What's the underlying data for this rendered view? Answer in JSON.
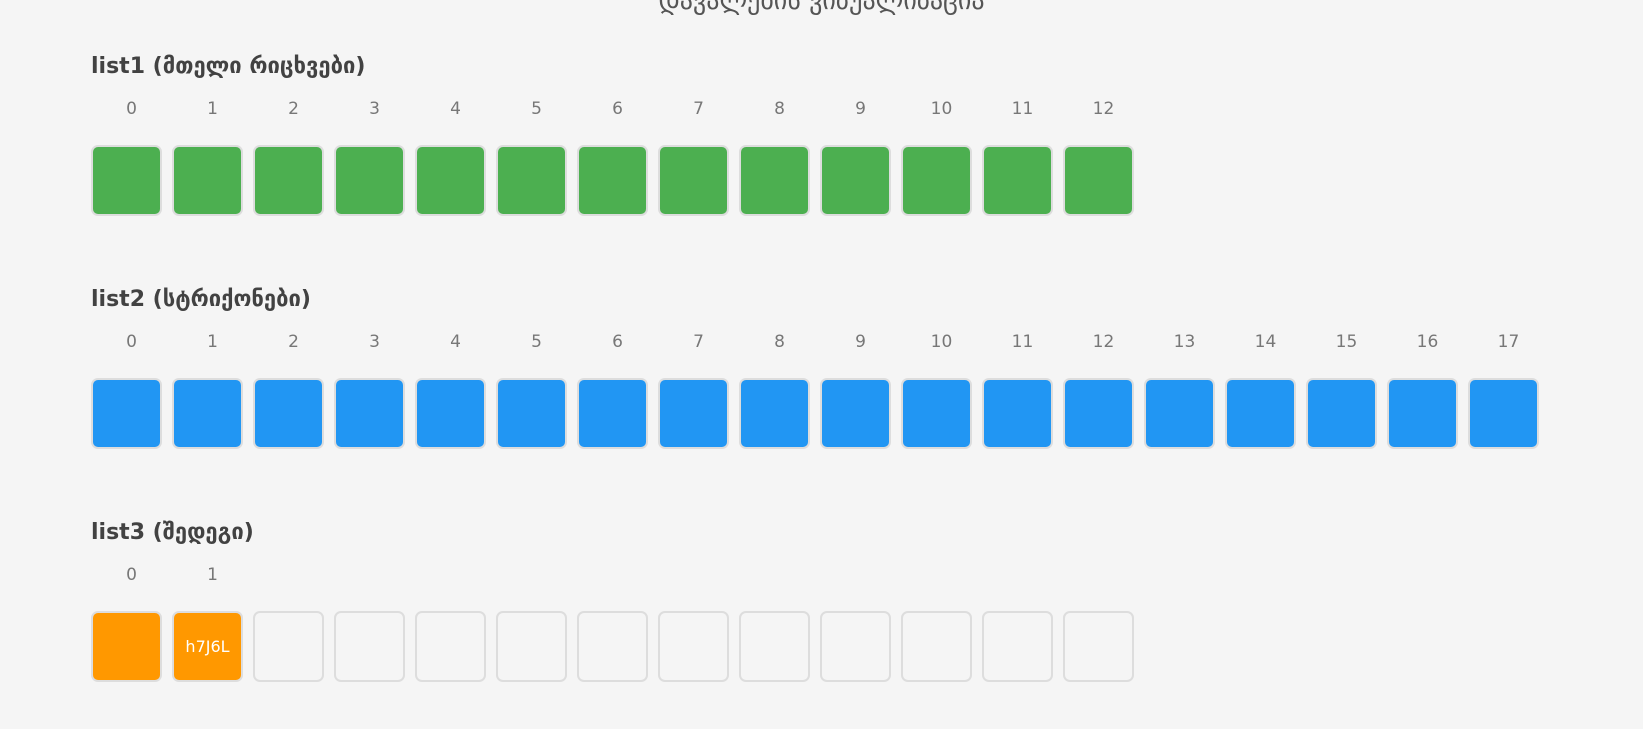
{
  "page": {
    "title": "დავალების ვიზუალიზაცია"
  },
  "colors": {
    "int": "#4caf50",
    "str": "#2196f3",
    "result": "#ff9800",
    "empty_border": "#dddddd"
  },
  "list1": {
    "title": "list1 (მთელი რიცხვები)",
    "indices": [
      "0",
      "1",
      "2",
      "3",
      "4",
      "5",
      "6",
      "7",
      "8",
      "9",
      "10",
      "11",
      "12"
    ],
    "cells": [
      "",
      "",
      "",
      "",
      "",
      "",
      "",
      "",
      "",
      "",
      "",
      "",
      ""
    ]
  },
  "list2": {
    "title": "list2 (სტრიქონები)",
    "indices": [
      "0",
      "1",
      "2",
      "3",
      "4",
      "5",
      "6",
      "7",
      "8",
      "9",
      "10",
      "11",
      "12",
      "13",
      "14",
      "15",
      "16",
      "17"
    ],
    "cells": [
      "",
      "",
      "",
      "",
      "",
      "",
      "",
      "",
      "",
      "",
      "",
      "",
      "",
      "",
      "",
      "",
      "",
      ""
    ]
  },
  "list3": {
    "title": "list3 (შედეგი)",
    "indices": [
      "0",
      "1"
    ],
    "cells": [
      "",
      "h7J6L"
    ],
    "empty_slots": 11
  }
}
